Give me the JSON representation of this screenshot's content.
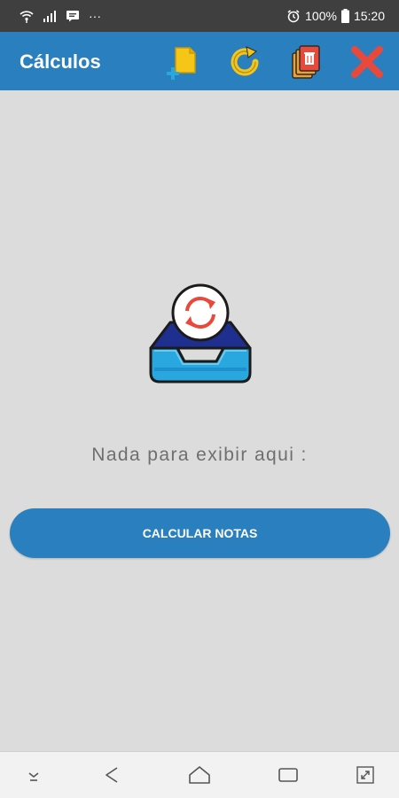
{
  "status_bar": {
    "icons": [
      "wifi-icon",
      "signal-icon",
      "message-notification-icon",
      "more-notifications-icon",
      "alarm-icon",
      "battery-icon"
    ],
    "ellipsis": "···",
    "battery_percent": "100%",
    "time": "15:20"
  },
  "app_bar": {
    "title": "Cálculos",
    "actions": [
      {
        "name": "add-document-button",
        "icon": "add-document-icon"
      },
      {
        "name": "refresh-button",
        "icon": "refresh-icon"
      },
      {
        "name": "delete-all-button",
        "icon": "delete-documents-icon"
      },
      {
        "name": "close-button",
        "icon": "close-icon"
      }
    ],
    "colors": {
      "primary": "#2a7fbf",
      "icon_yellow": "#f5c518",
      "icon_red": "#e8493a"
    }
  },
  "main": {
    "empty_state_icon": "empty-inbox-refresh-icon",
    "empty_message": "Nada para exibir aqui :",
    "calculate_button_label": "CALCULAR NOTAS"
  },
  "nav_bar": {
    "items": [
      "hide-keyboard-icon",
      "back-icon",
      "home-icon",
      "recents-icon",
      "expand-icon"
    ]
  }
}
